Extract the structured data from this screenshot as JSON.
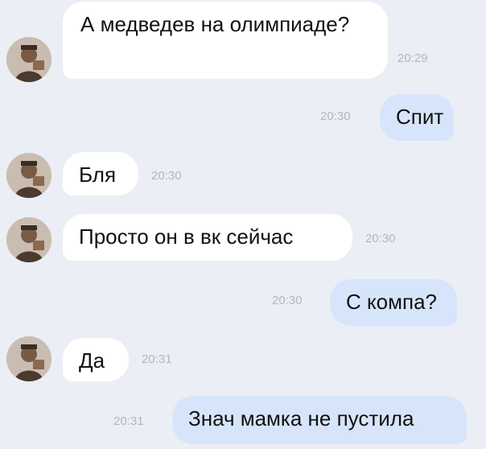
{
  "messages": [
    {
      "direction": "incoming",
      "text": "А медведев на олимпиаде?",
      "time": "20:29"
    },
    {
      "direction": "outgoing",
      "text": "Спит",
      "time": "20:30"
    },
    {
      "direction": "incoming",
      "text": "Бля",
      "time": "20:30"
    },
    {
      "direction": "incoming",
      "text": "Просто он в вк сейчас",
      "time": "20:30"
    },
    {
      "direction": "outgoing",
      "text": "С компа?",
      "time": "20:30"
    },
    {
      "direction": "incoming",
      "text": "Да",
      "time": "20:31"
    },
    {
      "direction": "outgoing",
      "text": "Знач мамка не пустила",
      "time": "20:31"
    }
  ],
  "colors": {
    "background": "#eceef5",
    "incoming_bubble": "#ffffff",
    "outgoing_bubble": "#d7e5fb",
    "timestamp": "#b1b6c0"
  },
  "icons": {
    "contact_avatar": "avatar-icon"
  }
}
